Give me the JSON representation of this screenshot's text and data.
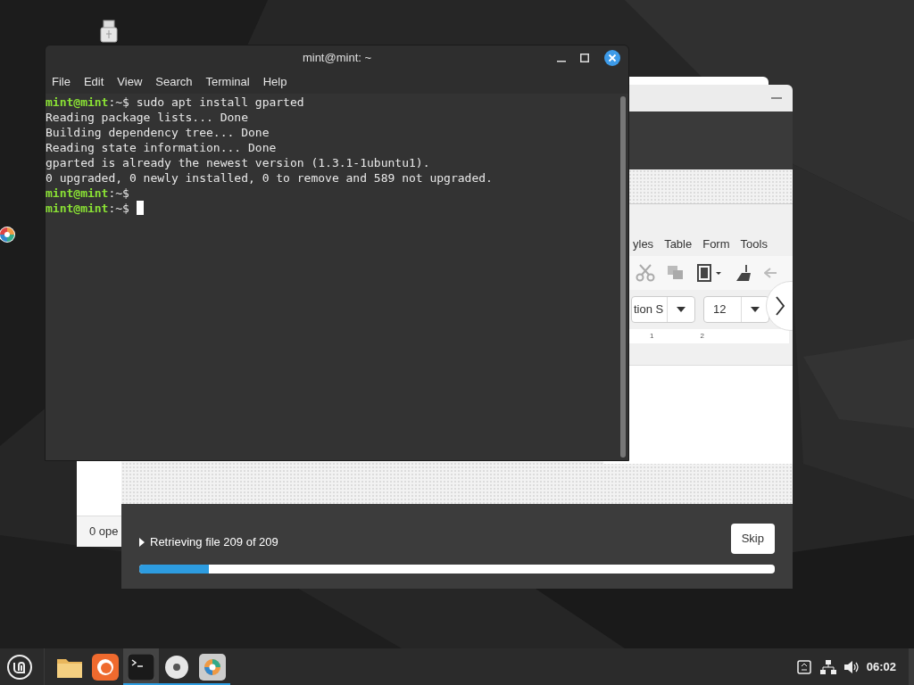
{
  "back_window": {
    "status_text": "0 ope"
  },
  "installer": {
    "slideshow": {
      "menu": [
        "yles",
        "Table",
        "Form",
        "Tools"
      ],
      "font_name": "tion S",
      "font_size": "12",
      "ruler_numbers": [
        "1",
        "2"
      ]
    },
    "progress": {
      "label": "Retrieving file 209 of 209",
      "level": 0.11
    },
    "skip_button": "Skip"
  },
  "terminal": {
    "title": "mint@mint: ~",
    "menu": [
      "File",
      "Edit",
      "View",
      "Search",
      "Terminal",
      "Help"
    ],
    "lines": [
      {
        "kind": "prompt",
        "prompt": "mint@mint",
        "path": ":~$",
        "command": "sudo apt install gparted"
      },
      {
        "kind": "output",
        "text": "Reading package lists... Done"
      },
      {
        "kind": "output",
        "text": "Building dependency tree... Done"
      },
      {
        "kind": "output",
        "text": "Reading state information... Done"
      },
      {
        "kind": "output",
        "text": "gparted is already the newest version (1.3.1-1ubuntu1)."
      },
      {
        "kind": "output",
        "text": "0 upgraded, 0 newly installed, 0 to remove and 589 not upgraded."
      },
      {
        "kind": "prompt",
        "prompt": "mint@mint",
        "path": ":~$"
      },
      {
        "kind": "prompt",
        "prompt": "mint@mint",
        "path": ":~$",
        "cursor": true
      }
    ]
  },
  "taskbar": {
    "launchers": [
      {
        "kind": "folder",
        "running": false,
        "active": false
      },
      {
        "kind": "firefox",
        "running": false,
        "active": false
      },
      {
        "kind": "terminal",
        "running": true,
        "active": true
      },
      {
        "kind": "disc",
        "running": true,
        "active": false
      },
      {
        "kind": "installer",
        "running": true,
        "active": false
      }
    ],
    "clock": "06:02"
  }
}
